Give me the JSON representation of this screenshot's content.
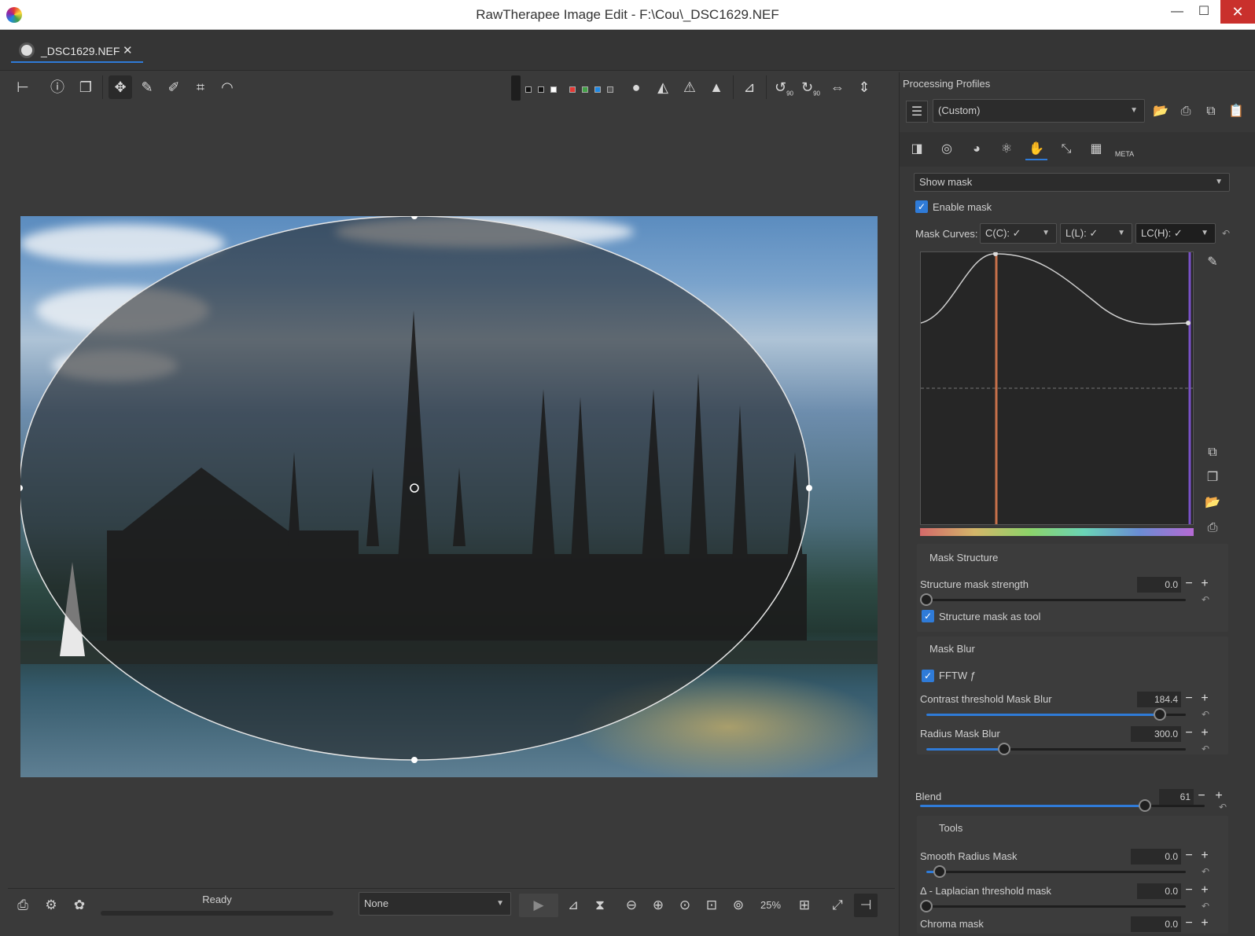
{
  "window": {
    "title": "RawTherapee Image Edit - F:\\Cou\\_DSC1629.NEF",
    "minimize": "—",
    "maximize": "☐",
    "close": "✕"
  },
  "tab": {
    "label": "_DSC1629.NEF",
    "close": "✕"
  },
  "toolbar": {
    "icons": [
      "panel-toggle-icon",
      "info-icon",
      "before-after-icon",
      "hand-tool-icon",
      "color-picker-icon",
      "white-balance-picker-icon",
      "crop-icon",
      "straighten-icon",
      "focus-mask-icon",
      "shadow-clip-icon",
      "highlight-clip-warning-icon",
      "clip-warning-icon",
      "histogram-icon",
      "rotate-left-icon",
      "rotate-right-icon",
      "flip-horizontal-icon",
      "flip-vertical-icon"
    ],
    "rotate_left_label": "90",
    "rotate_right_label": "90",
    "swatch_colors": [
      "#111111",
      "#111111",
      "#ffffff",
      "#e53935",
      "#43a047",
      "#1e88e5",
      "#555555"
    ]
  },
  "preview": {
    "mask_shape": "ellipse"
  },
  "profiles": {
    "heading": "Processing Profiles",
    "selected": "(Custom)"
  },
  "tool_tabs": [
    "exposure-tab-icon",
    "detail-tab-icon",
    "color-tab-icon",
    "advanced-tab-icon",
    "local-adjustments-tab-icon",
    "transform-tab-icon",
    "raw-tab-icon",
    "meta-tab-icon"
  ],
  "meta_tab_label": "META",
  "mask": {
    "show_mask": "Show mask",
    "enable_mask": "Enable mask",
    "curves_label": "Mask Curves:",
    "curve_cc": "C(C):",
    "curve_ll": "L(L):",
    "curve_lch": "LC(H):",
    "curve_cc_icon": "✓",
    "curve_ll_icon": "✓",
    "curve_lch_icon": "✓"
  },
  "structure": {
    "heading": "Mask Structure",
    "strength_label": "Structure mask strength",
    "strength_value": "0.0",
    "strength_fraction": 0.0,
    "as_tool_label": "Structure mask as tool"
  },
  "blur": {
    "heading": "Mask Blur",
    "fftw_label": "FFTW ƒ",
    "contrast_label": "Contrast threshold Mask Blur",
    "contrast_value": "184.4",
    "contrast_fraction": 0.9,
    "radius_label": "Radius Mask Blur",
    "radius_value": "300.0",
    "radius_fraction": 0.3
  },
  "blend": {
    "label": "Blend",
    "value": "61",
    "fraction": 0.79
  },
  "tools": {
    "heading": "Tools",
    "smooth_label": "Smooth Radius Mask",
    "smooth_value": "0.0",
    "smooth_fraction": 0.05,
    "laplacian_label": "Δ - Laplacian threshold mask",
    "laplacian_value": "0.0",
    "laplacian_fraction": 0.0,
    "chroma_label": "Chroma mask",
    "chroma_value": "0.0"
  },
  "status": {
    "text": "Ready",
    "output_profile": "None",
    "zoom": "25%"
  },
  "colors": {
    "accent": "#2f7bd8",
    "curve_orange": "#c8714a",
    "curve_purple": "#7a52c9"
  }
}
